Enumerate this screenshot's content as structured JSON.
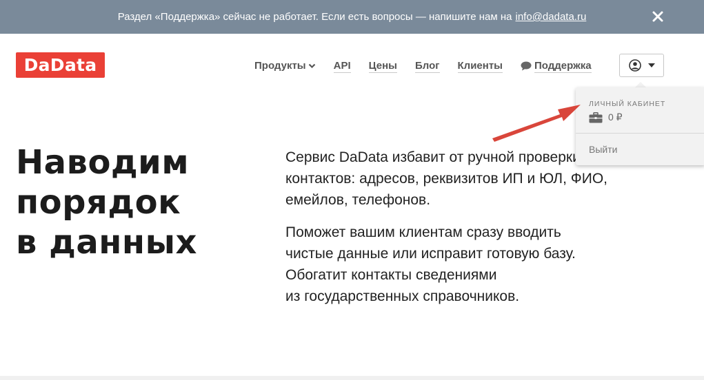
{
  "notice": {
    "text": "Раздел «Поддержка» сейчас не работает. Если есть вопросы — напишите нам на",
    "email": "info@dadata.ru"
  },
  "header": {
    "logo": "DaData",
    "nav": [
      {
        "label": "Продукты"
      },
      {
        "label": "API"
      },
      {
        "label": "Цены"
      },
      {
        "label": "Блог"
      },
      {
        "label": "Клиенты"
      },
      {
        "label": "Поддержка"
      }
    ]
  },
  "dropdown": {
    "title": "Личный кабинет",
    "balance": "0 ₽",
    "logout": "Выйти"
  },
  "hero": {
    "title_lines": [
      "Наводим",
      "порядок",
      "в данных"
    ],
    "paragraph1_lines": [
      "Сервис DaData избавит от ручной проверки",
      "контактов: адресов, реквизитов ИП и ЮЛ, ФИО,",
      "емейлов, телефонов."
    ],
    "paragraph2_lines": [
      "Поможет вашим клиентам сразу вводить",
      "чистые данные или исправит готовую базу.",
      "Обогатит контакты сведениями",
      "из государственных справочников."
    ]
  },
  "colors": {
    "notice_bg": "#7a8a9a",
    "brand": "#ea4036",
    "annotation_arrow": "#d9463b"
  },
  "icons": {
    "notice_close": "close-icon",
    "products_chevron": "chevron-down-icon",
    "support": "chat-bubble-icon",
    "user": "user-icon",
    "user_caret": "caret-down-icon",
    "balance": "briefcase-icon"
  }
}
